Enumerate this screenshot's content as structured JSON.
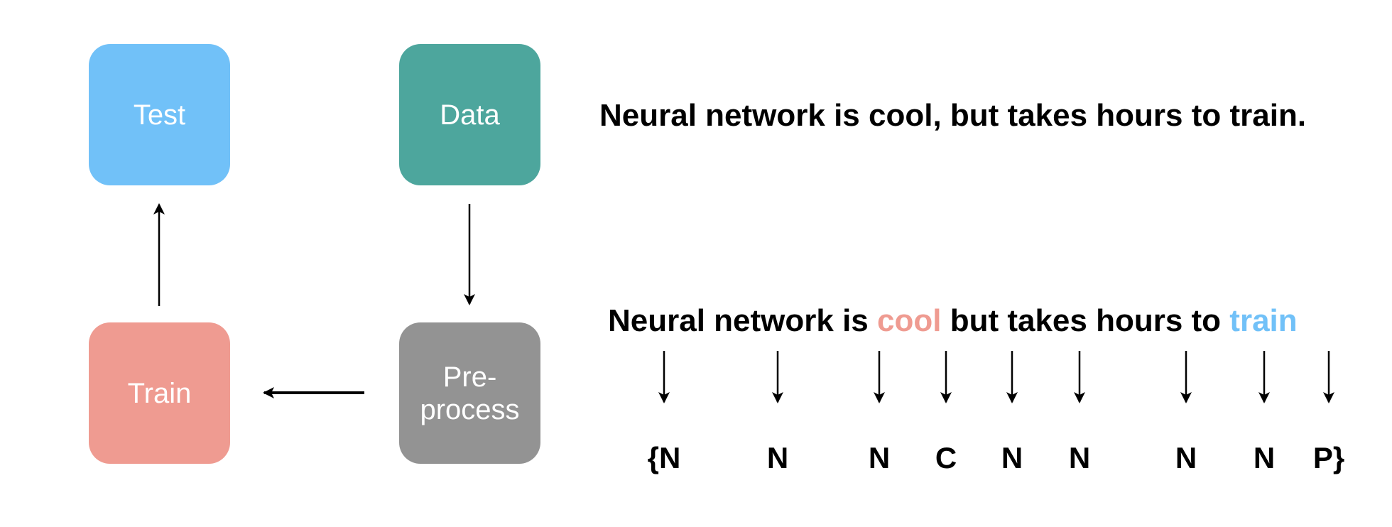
{
  "boxes": {
    "test": {
      "label": "Test",
      "color": "#71c1f8"
    },
    "data": {
      "label": "Data",
      "color": "#4da69d"
    },
    "train": {
      "label": "Train",
      "color": "#ef9b91"
    },
    "preprocess": {
      "label_line1": "Pre-",
      "label_line2": "process",
      "color": "#939393"
    }
  },
  "sentence_full": "Neural network is cool, but takes hours to train.",
  "sentence_tokens": {
    "part1": "Neural network is ",
    "cool": "cool",
    "part2": " but takes hours to ",
    "train": "train",
    "cool_color": "#ef9b91",
    "train_color": "#71c1f8"
  },
  "tags": [
    "{N",
    "N",
    "N",
    "C",
    "N",
    "N",
    "N",
    "N",
    "P}"
  ]
}
